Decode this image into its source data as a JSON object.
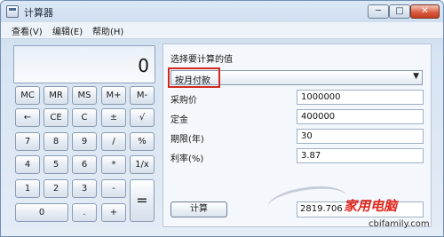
{
  "window": {
    "title": "计算器"
  },
  "menu": {
    "items": [
      "查看(V)",
      "编辑(E)",
      "帮助(H)"
    ]
  },
  "display": {
    "value": "0"
  },
  "keypad": {
    "rows": [
      [
        "MC",
        "MR",
        "MS",
        "M+",
        "M-"
      ],
      [
        "←",
        "CE",
        "C",
        "±",
        "√"
      ],
      [
        "7",
        "8",
        "9",
        "/",
        "%"
      ],
      [
        "4",
        "5",
        "6",
        "*",
        "1/x"
      ],
      [
        "1",
        "2",
        "3",
        "-",
        "="
      ],
      [
        "0",
        ".",
        "+"
      ]
    ]
  },
  "panel": {
    "title": "选择要计算的值",
    "mode": "按月付款",
    "fields": [
      {
        "label": "采购价",
        "value": "1000000"
      },
      {
        "label": "定金",
        "value": "400000"
      },
      {
        "label": "期限(年)",
        "value": "30"
      },
      {
        "label": "利率(%)",
        "value": "3.87"
      }
    ],
    "calculate_label": "计算",
    "result": "2819.706"
  },
  "watermark": {
    "logo": "家用电脑",
    "url": "cbifamily.com"
  },
  "colors": {
    "highlight": "#d22a1f",
    "window_frame": "#6f8fb3"
  }
}
